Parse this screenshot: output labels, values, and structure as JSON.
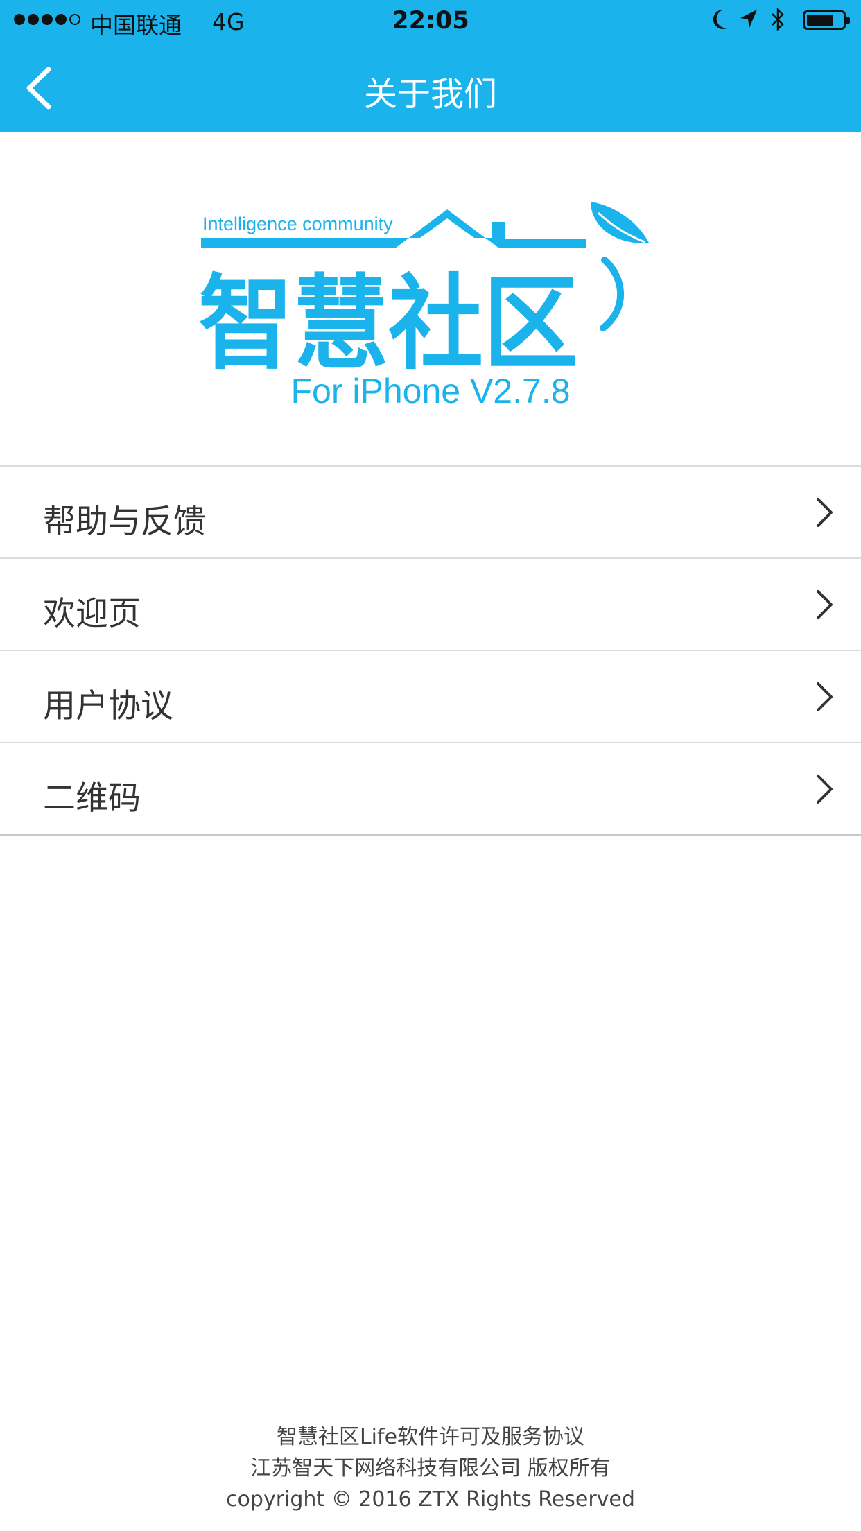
{
  "status_bar": {
    "carrier": "中国联通",
    "network": "4G",
    "time": "22:05",
    "icons": [
      "moon-icon",
      "location-arrow-icon",
      "bluetooth-icon",
      "battery-icon"
    ]
  },
  "nav": {
    "title": "关于我们",
    "back_icon": "chevron-left-icon"
  },
  "logo": {
    "tagline": "Intelligence community",
    "name": "智慧社区",
    "version": "For iPhone V2.7.8"
  },
  "menu": {
    "items": [
      {
        "label": "帮助与反馈"
      },
      {
        "label": "欢迎页"
      },
      {
        "label": "用户协议"
      },
      {
        "label": "二维码"
      }
    ]
  },
  "footer": {
    "line1": "智慧社区Life软件许可及服务协议",
    "line2": "江苏智天下网络科技有限公司 版权所有",
    "line3": "copyright © 2016 ZTX Rights Reserved"
  },
  "colors": {
    "accent": "#1ab3ec",
    "text": "#333333",
    "divider": "#dcdcdc"
  }
}
